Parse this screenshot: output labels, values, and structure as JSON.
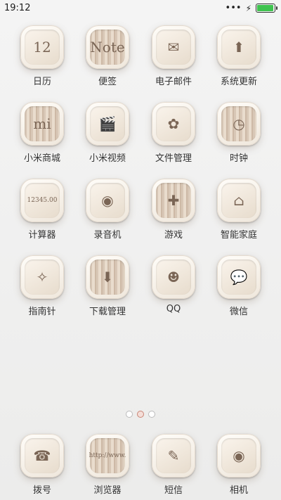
{
  "status_bar": {
    "time": "19:12",
    "signal_indicator": "•••",
    "charging_icon": "lightning-bolt"
  },
  "apps": [
    {
      "label": "日历",
      "glyph": "12",
      "icon": "calendar-icon"
    },
    {
      "label": "便签",
      "glyph": "Note",
      "icon": "notes-icon"
    },
    {
      "label": "电子邮件",
      "glyph": "✉",
      "icon": "email-icon"
    },
    {
      "label": "系统更新",
      "glyph": "⬆",
      "icon": "update-icon"
    },
    {
      "label": "小米商城",
      "glyph": "mi",
      "icon": "shopping-bag-icon"
    },
    {
      "label": "小米视频",
      "glyph": "🎬",
      "icon": "video-icon"
    },
    {
      "label": "文件管理",
      "glyph": "✿",
      "icon": "file-manager-icon"
    },
    {
      "label": "时钟",
      "glyph": "◷",
      "icon": "clock-icon"
    },
    {
      "label": "计算器",
      "glyph": "12345.00",
      "icon": "calculator-icon"
    },
    {
      "label": "录音机",
      "glyph": "◉",
      "icon": "recorder-icon"
    },
    {
      "label": "游戏",
      "glyph": "✚",
      "icon": "gamepad-icon"
    },
    {
      "label": "智能家庭",
      "glyph": "⌂",
      "icon": "smart-home-icon"
    },
    {
      "label": "指南针",
      "glyph": "✧",
      "icon": "compass-icon"
    },
    {
      "label": "下载管理",
      "glyph": "⬇",
      "icon": "download-icon"
    },
    {
      "label": "QQ",
      "glyph": "☻",
      "icon": "qq-icon"
    },
    {
      "label": "微信",
      "glyph": "💬",
      "icon": "wechat-icon"
    }
  ],
  "dock": [
    {
      "label": "拨号",
      "glyph": "☎",
      "icon": "dialer-icon"
    },
    {
      "label": "浏览器",
      "glyph": "http://www.",
      "icon": "browser-icon"
    },
    {
      "label": "短信",
      "glyph": "✎",
      "icon": "messages-icon"
    },
    {
      "label": "相机",
      "glyph": "◉",
      "icon": "camera-icon"
    }
  ],
  "page_indicator": {
    "count": 3,
    "active_index": 1
  }
}
